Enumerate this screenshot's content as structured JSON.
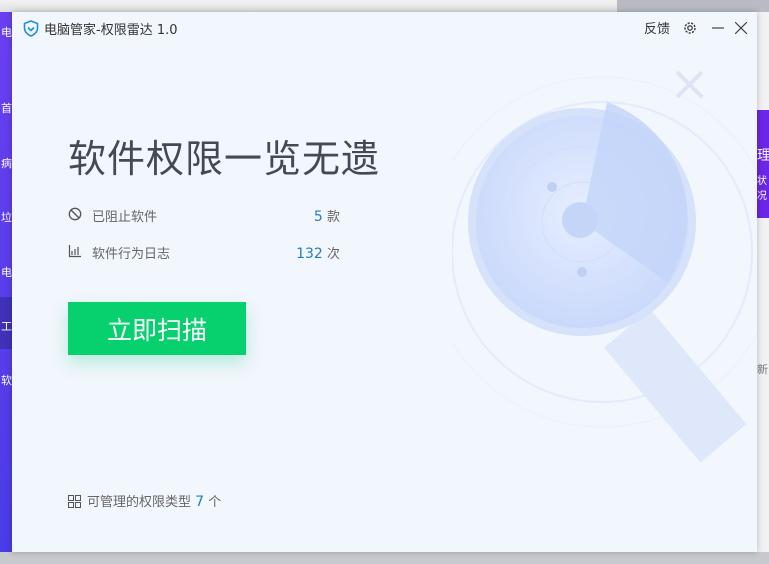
{
  "window": {
    "title": "电脑管家-权限雷达 1.0",
    "feedback": "反馈"
  },
  "headline": "软件权限一览无遗",
  "stats": [
    {
      "label": "已阻止软件",
      "value": "5",
      "unit": "款",
      "icon": "block-icon"
    },
    {
      "label": "软件行为日志",
      "value": "132",
      "unit": "次",
      "icon": "chart-icon"
    }
  ],
  "scan_button": "立即扫描",
  "footer": {
    "label": "可管理的权限类型",
    "value": "7",
    "unit": "个"
  },
  "background_app": {
    "left_items": [
      "电",
      "首",
      "病",
      "垃",
      "电",
      "工",
      "软"
    ],
    "right_texts": [
      "理",
      "状况",
      "新"
    ]
  },
  "colors": {
    "accent": "#07d06f",
    "number": "#1f7fc4",
    "sidebar": "#5a3eeb"
  }
}
